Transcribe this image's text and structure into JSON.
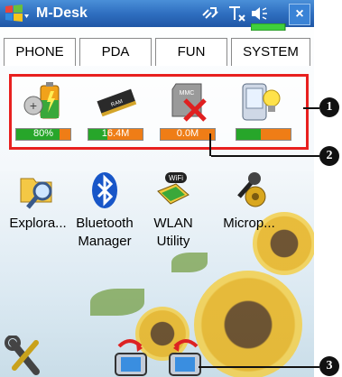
{
  "titlebar": {
    "title": "M-Desk",
    "close_label": "×"
  },
  "tabs": [
    "PHONE",
    "PDA",
    "FUN",
    "SYSTEM"
  ],
  "status": {
    "battery": {
      "label": "80%",
      "level": 0.8
    },
    "memory": {
      "label": "16.4M",
      "level": 0.35
    },
    "storage": {
      "label": "0.0M",
      "level": 0.0
    },
    "backlight": {
      "label": "",
      "level": 0.45
    }
  },
  "apps": [
    {
      "name": "Explora...",
      "name2": ""
    },
    {
      "name": "Bluetooth",
      "name2": "Manager"
    },
    {
      "name": "WLAN",
      "name2": "Utility"
    },
    {
      "name": "Microp...",
      "name2": ""
    }
  ],
  "callouts": {
    "c1": "1",
    "c2": "2",
    "c3": "3"
  },
  "colors": {
    "titlebar": "#2f6fc0",
    "highlight": "#e8201f",
    "bar_green": "#27a62a",
    "bar_orange": "#ef7d16"
  },
  "icons": [
    "windows-start-icon",
    "connectivity-icon",
    "signal-icon",
    "volume-icon",
    "battery-status-icon",
    "battery-icon",
    "memory-chip-icon",
    "mmc-card-icon",
    "backlight-icon",
    "explorer-icon",
    "bluetooth-icon",
    "wlan-icon",
    "microphone-icon",
    "settings-wrench-icon",
    "rotate-right-icon",
    "rotate-left-icon"
  ]
}
